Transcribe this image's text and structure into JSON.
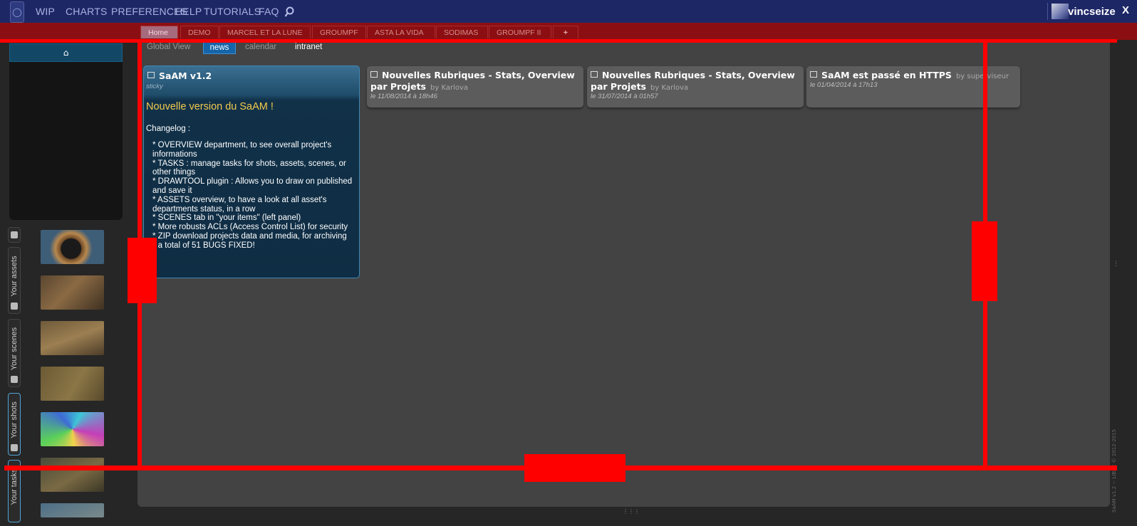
{
  "topnav": {
    "items": [
      "WIP",
      "CHARTS",
      "PREFERENCES",
      "HELP",
      "TUTORIALS",
      "FAQ"
    ],
    "search_icon": "search-icon",
    "logo_icon": "app-logo-icon",
    "username": "vincseize",
    "logout_label": "X"
  },
  "project_tabs": [
    "Home",
    "DEMO",
    "MARCEL ET LA LUNE",
    "GROUMPF",
    "ASTA LA VIDA",
    "SODIMAS",
    "GROUMPF II",
    "+"
  ],
  "sub_tabs": [
    "Global View",
    "news",
    "calendar",
    "intranet"
  ],
  "sidebar": {
    "home_icon": "home-icon",
    "tabs": [
      "Your assets",
      "Your scenes",
      "Your shots",
      "Your tasks"
    ]
  },
  "news": [
    {
      "title": "SaAM v1.2",
      "label": "sticky",
      "heading": "Nouvelle version du SaAM !",
      "changelog_title": "Changelog :",
      "changelog": [
        "* OVERVIEW department, to see overall project's informations",
        "* TASKS : manage tasks for shots, assets, scenes, or other things",
        "* DRAWTOOL plugin : Allows you to draw on published and save it",
        "* ASSETS overview, to have a look at all asset's departments status, in a row",
        "* SCENES tab in \"your items\" (left panel)",
        "* More robusts ACLs (Access Control List) for security",
        "* ZIP download projects data and media, for archiving",
        "* a total of 51 BUGS FIXED!"
      ]
    },
    {
      "title": "Nouvelles Rubriques - Stats, Overview par Projets",
      "by": "by Karlova",
      "date": "le 11/08/2014 à 18h46"
    },
    {
      "title": "Nouvelles Rubriques - Stats, Overview par Projets",
      "by": "by Karlova",
      "date": "le 31/07/2014 à 01h57"
    },
    {
      "title": "SaAM est passé en HTTPS",
      "by": "by superviseur",
      "date": "le 01/04/2014 à 17h13"
    }
  ],
  "credits": "SaAM v1.2 ~ LIBRE © 2012-2015",
  "colors": {
    "topbar": "#1e2766",
    "tabband": "#8b0f12",
    "accent": "#1565a8",
    "annotation": "#ff0000"
  }
}
